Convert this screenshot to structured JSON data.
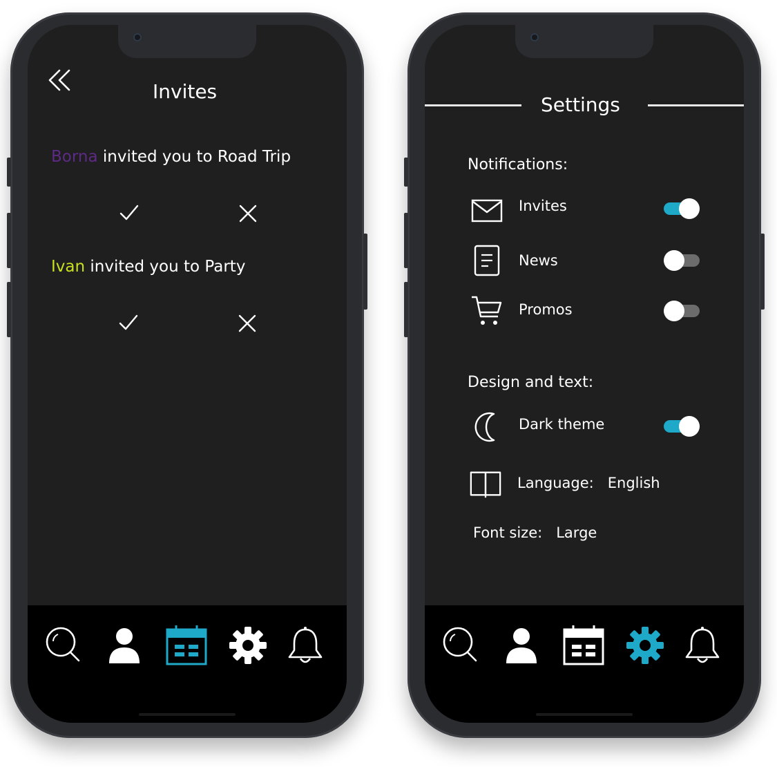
{
  "invites_screen": {
    "title": "Invites",
    "invites": [
      {
        "sender": "Borna",
        "sender_color": "#5d2a86",
        "text": " invited you to Road Trip"
      },
      {
        "sender": "Ivan",
        "sender_color": "#c8e021",
        "text": " invited you to Party"
      }
    ],
    "active_tab": "calendar-tab"
  },
  "settings_screen": {
    "title": "Settings",
    "notifications_heading": "Notifications:",
    "notifications": [
      {
        "label": "Invites",
        "icon": "mail-icon",
        "enabled": true
      },
      {
        "label": "News",
        "icon": "document-icon",
        "enabled": false
      },
      {
        "label": "Promos",
        "icon": "cart-icon",
        "enabled": false
      }
    ],
    "design_heading": "Design and text:",
    "dark_theme": {
      "label": "Dark theme",
      "icon": "moon-icon",
      "enabled": true
    },
    "language": {
      "label": "Language:",
      "value": "English",
      "icon": "book-icon"
    },
    "font_size": {
      "label": "Font size:",
      "value": "Large"
    },
    "active_tab": "settings-tab"
  },
  "tabs": [
    "search-tab",
    "profile-tab",
    "calendar-tab",
    "settings-tab",
    "notifications-tab"
  ],
  "colors": {
    "accent": "#1fa9c9",
    "screen_bg": "#1f1f1f",
    "tabbar_bg": "#000000",
    "text": "#ffffff"
  }
}
